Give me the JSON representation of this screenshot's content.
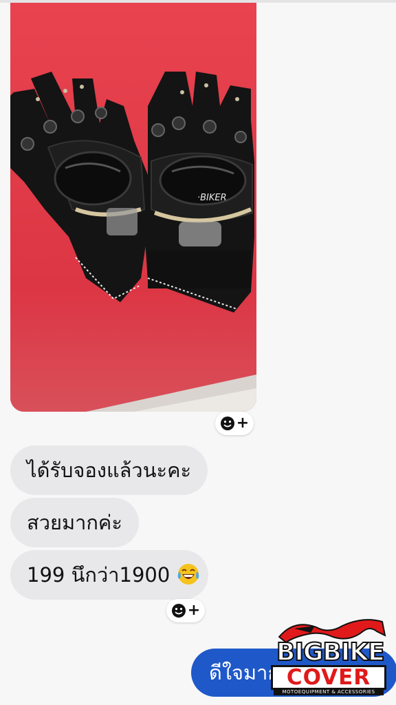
{
  "chat": {
    "photo": {
      "glove_brand_text": "·BIKER"
    },
    "react_plus": "+",
    "messages_in": [
      {
        "text": "ได้รับจองแล้วนะคะ"
      },
      {
        "text": "สวยมากค่ะ"
      },
      {
        "text": "199 นึกว่า1900",
        "emoji": "tears-of-joy-emoji"
      }
    ],
    "message_out": {
      "text": "ดีใจมาก"
    }
  },
  "watermark": {
    "line1": "BIGBIKE",
    "line2": "COVER",
    "tagline": "MOTOEQUIPMENT & ACCESSORIES"
  },
  "colors": {
    "incoming_bubble": "#e8e8ea",
    "outgoing_bubble": "#1f58c8",
    "background": "#f7f7f8",
    "table_red": "#e23b4a",
    "logo_red": "#e01a1a"
  }
}
